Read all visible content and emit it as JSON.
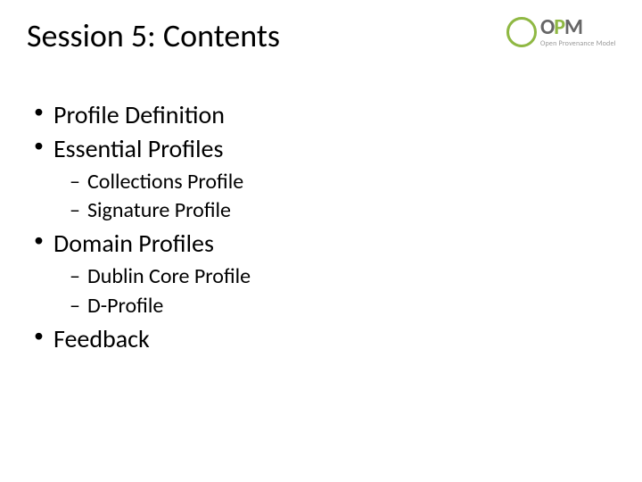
{
  "title": "Session 5: Contents",
  "logo": {
    "letters_prefix": "O",
    "letters_mid": "P",
    "letters_suffix": "M",
    "subtext": "Open Provenance Model"
  },
  "bullets": [
    {
      "label": "Profile Definition",
      "sub": []
    },
    {
      "label": "Essential Profiles",
      "sub": [
        "Collections Profile",
        "Signature Profile"
      ]
    },
    {
      "label": "Domain Profiles",
      "sub": [
        "Dublin Core Profile",
        "D-Profile"
      ]
    },
    {
      "label": "Feedback",
      "sub": []
    }
  ]
}
